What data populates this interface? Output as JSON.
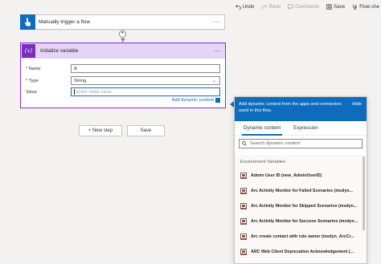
{
  "toolbar": {
    "undo": "Undo",
    "redo": "Redo",
    "comments": "Comments",
    "save": "Save",
    "flow_checker": "Flow che"
  },
  "trigger": {
    "title": "Manually trigger a flow",
    "icon": "hand-pointer-icon",
    "menu": "···"
  },
  "connector": {
    "plus": "+"
  },
  "initialize_variable": {
    "title": "Initialize variable",
    "icon_text": "{x}",
    "menu": "···",
    "name_label": "Name",
    "name_value": "A",
    "type_label": "Type",
    "type_value": "String",
    "value_label": "Value",
    "value_placeholder": "Enter initial value",
    "required_mark": "*",
    "add_dynamic": "Add dynamic content"
  },
  "actions": {
    "new_step": "+ New step",
    "save": "Save"
  },
  "dynamic_panel": {
    "header_text": "Add dynamic content from the apps and connectors used in this flow.",
    "hide": "Hide",
    "tabs": [
      "Dynamic content",
      "Expression"
    ],
    "search_placeholder": "Search dynamic content",
    "section": "Environment Variables",
    "items": [
      "Admin User ID (new_AdminUserID)",
      "Arc Activity Monitor for Failed Scenarios (msdyn...",
      "Arc Activity Monitor for Skipped Scenarios (msdyn...",
      "Arc Activity Monitor for Success Scenarios (msdyn...",
      "Arc create contact with rule owner (msdyn_ArcCr...",
      "ARC Web Client Deprecation Acknowledgement (..."
    ]
  },
  "colors": {
    "accent": "#0f6cbd",
    "variable_purple": "#7a2fbf",
    "variable_header": "#e4d4f5",
    "item_icon": "#8b5a4f"
  }
}
